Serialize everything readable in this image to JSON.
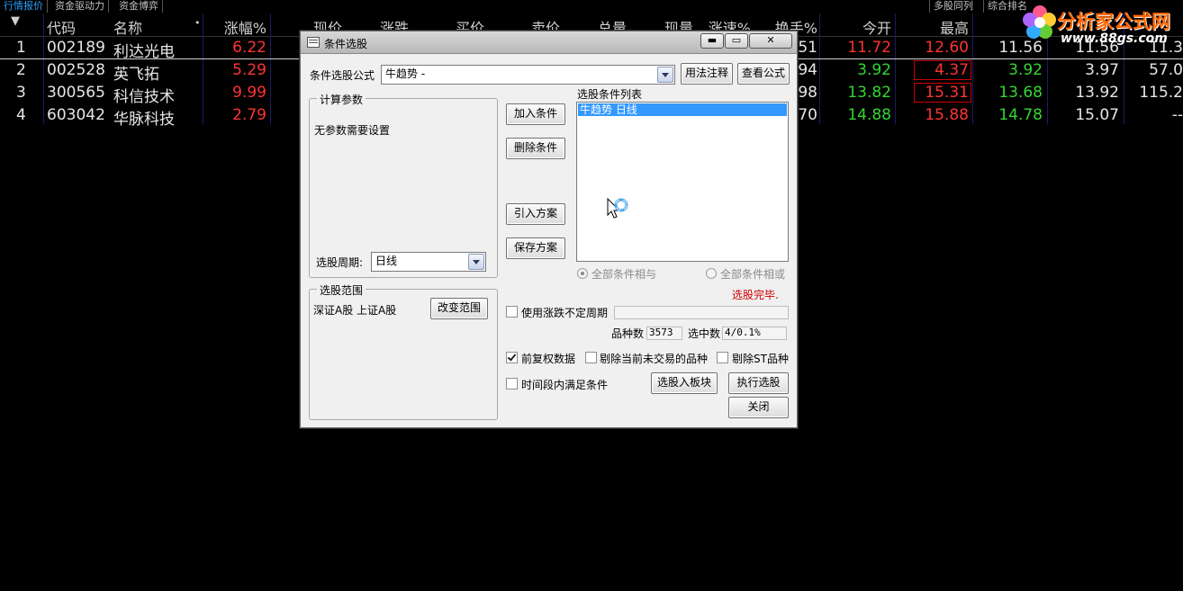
{
  "top_tabs": [
    "行情报价",
    "资金驱动力",
    "资金博弈"
  ],
  "right_tabs": [
    "多股同列",
    "综合排名"
  ],
  "watermark": {
    "title": "分析家公式网",
    "url": "www.88gs.com"
  },
  "table": {
    "headers": {
      "sort": "▼",
      "code": "代码",
      "name": "名称",
      "change_pct": "涨幅%",
      "price": "现价",
      "change": "涨跌",
      "bid": "买价",
      "ask": "卖价",
      "volume": "总量",
      "cur_vol": "现量",
      "speed": "涨速%",
      "turnover": "换手%",
      "open": "今开",
      "high": "最高"
    },
    "rows": [
      {
        "idx": "1",
        "code": "002189",
        "name": "利达光电",
        "change_pct": "6.22",
        "turnover": "51",
        "open": "11.72",
        "high": "12.60",
        "low": "11.56",
        "prev": "11.56",
        "extra": "11.3"
      },
      {
        "idx": "2",
        "code": "002528",
        "name": "英飞拓",
        "change_pct": "5.29",
        "turnover": "94",
        "open": "3.92",
        "high": "4.37",
        "low": "3.92",
        "prev": "3.97",
        "extra": "57.0"
      },
      {
        "idx": "3",
        "code": "300565",
        "name": "科信技术",
        "change_pct": "9.99",
        "turnover": "98",
        "open": "13.82",
        "high": "15.31",
        "low": "13.68",
        "prev": "13.92",
        "extra": "115.2"
      },
      {
        "idx": "4",
        "code": "603042",
        "name": "华脉科技",
        "change_pct": "2.79",
        "turnover": "70",
        "open": "14.88",
        "high": "15.88",
        "low": "14.78",
        "prev": "15.07",
        "extra": "--"
      }
    ]
  },
  "dialog": {
    "title": "条件选股",
    "formula_label": "条件选股公式",
    "formula_value": "牛趋势          -",
    "usage_button": "用法注释",
    "view_formula_button": "查看公式",
    "params_group": "计算参数",
    "params_text": "无参数需要设置",
    "period_label": "选股周期:",
    "period_value": "日线",
    "add_condition": "加入条件",
    "delete_condition": "删除条件",
    "import_plan": "引入方案",
    "save_plan": "保存方案",
    "conditions_label": "选股条件列表",
    "conditions": [
      "牛趋势   日线"
    ],
    "all_and": "全部条件相与",
    "all_or": "全部条件相或",
    "status": "选股完毕.",
    "range_group": "选股范围",
    "range_text": "深证A股 上证A股",
    "change_range": "改变范围",
    "use_period": "使用涨跌不定周期",
    "count_label": "品种数",
    "count_value": "3573",
    "selected_label": "选中数",
    "selected_value": "4/0.1%",
    "adjusted_data": "前复权数据",
    "exclude_untraded": "剔除当前未交易的品种",
    "exclude_st": "剔除ST品种",
    "time_period": "时间段内满足条件",
    "to_block": "选股入板块",
    "execute": "执行选股",
    "close": "关闭"
  }
}
